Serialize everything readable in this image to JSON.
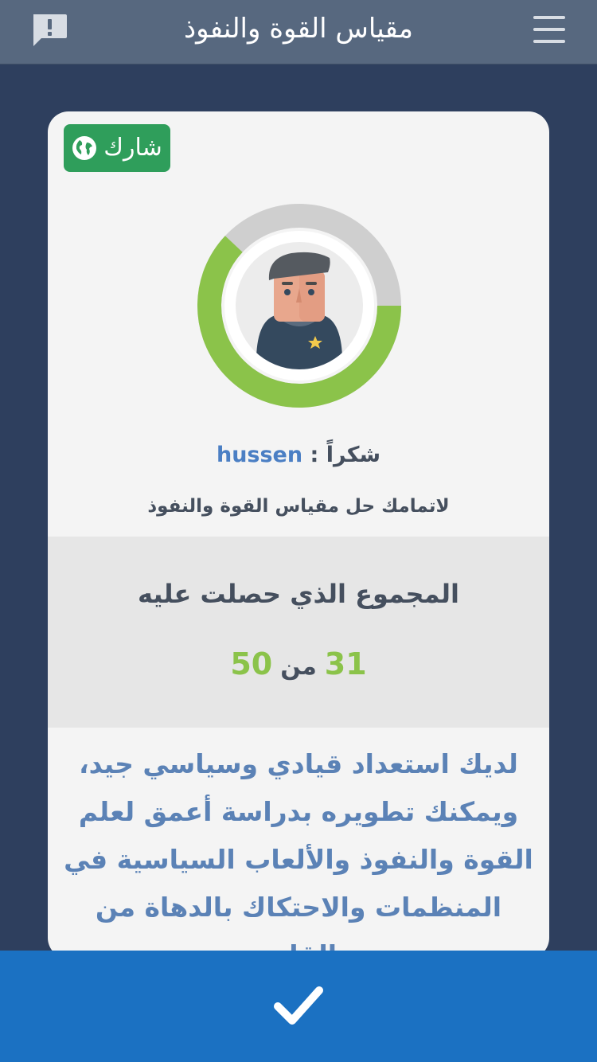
{
  "header": {
    "title": "مقياس القوة والنفوذ",
    "menu_icon": "hamburger-menu-icon",
    "report_icon": "report-alert-icon"
  },
  "card": {
    "share_label": "شارك",
    "share_icon": "globe-icon",
    "progress_fraction": 0.62,
    "progress_color": "#8bc34a",
    "track_color": "#cfcfcf",
    "avatar_icon": "man-avatar-icon",
    "thanks_word": "شكراً",
    "separator": " : ",
    "user_name": "hussen",
    "completion_text": "لاتمامك حل  مقياس القوة والنفوذ",
    "score_heading": "المجموع الذي حصلت عليه",
    "score_value": "31",
    "score_of": "من",
    "score_max": "50",
    "result_text": "لديك استعداد قيادي وسياسي جيد، ويمكنك تطويره بدراسة أعمق لعلم القوة والنفوذ والألعاب السياسية في المنظمات والاحتكاك بالدهاة من القادة"
  },
  "footer": {
    "confirm_icon": "checkmark-icon",
    "color": "#1b71c2"
  },
  "colors": {
    "background": "#2e3f5e",
    "topbar": "#57687f",
    "share_green": "#2f9e5b",
    "accent_green": "#8bc34a",
    "result_blue": "#5b82b6"
  }
}
